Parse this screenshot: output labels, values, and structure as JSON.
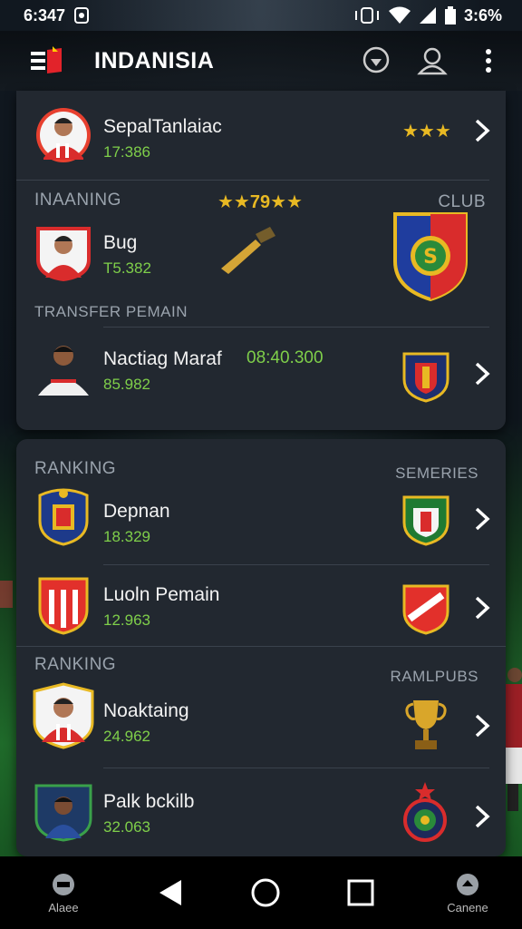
{
  "status": {
    "time": "6:347",
    "battery": "3:6%"
  },
  "app": {
    "title": "INDANISIA"
  },
  "card1": {
    "row1": {
      "title": "SepalTanlaiac",
      "sub": "17:386",
      "rating": "★★★"
    },
    "inaaning": {
      "label": "INAANING",
      "stars": "★★79★★",
      "club_label": "CLUB"
    },
    "row2": {
      "title": "Bug",
      "sub": "T5.382"
    },
    "transfer_label": "TRANSFER PEMAIN",
    "row3": {
      "title": "Nactiag Maraf",
      "value": "‎08:40.300",
      "sub": "85.982"
    }
  },
  "card2": {
    "ranking1": {
      "label": "RANKING",
      "right": "SEMERIES"
    },
    "row1": {
      "title": "Depnan",
      "sub": "18.329"
    },
    "row2": {
      "title": "Luoln Pemain",
      "sub": "12.963"
    },
    "ranking2": {
      "label": "RANKING",
      "right": "RAMLPUBS"
    },
    "row3": {
      "title": "Noaktaing",
      "sub": "24.962"
    },
    "row4": {
      "title": "Palk bckilb",
      "sub": "32.063"
    }
  },
  "nav": {
    "left_label": "Alaee",
    "right_label": "Canene"
  },
  "colors": {
    "accent_green": "#7fcf4a",
    "card_bg": "#222830",
    "gold": "#e8b923"
  },
  "icons": [
    "signal-icon",
    "wifi-icon",
    "battery-icon",
    "pin-icon",
    "profile-icon",
    "more-icon",
    "chevron-right-icon",
    "back-icon",
    "home-icon",
    "recents-icon",
    "trophy-icon",
    "club-badge-icon"
  ]
}
